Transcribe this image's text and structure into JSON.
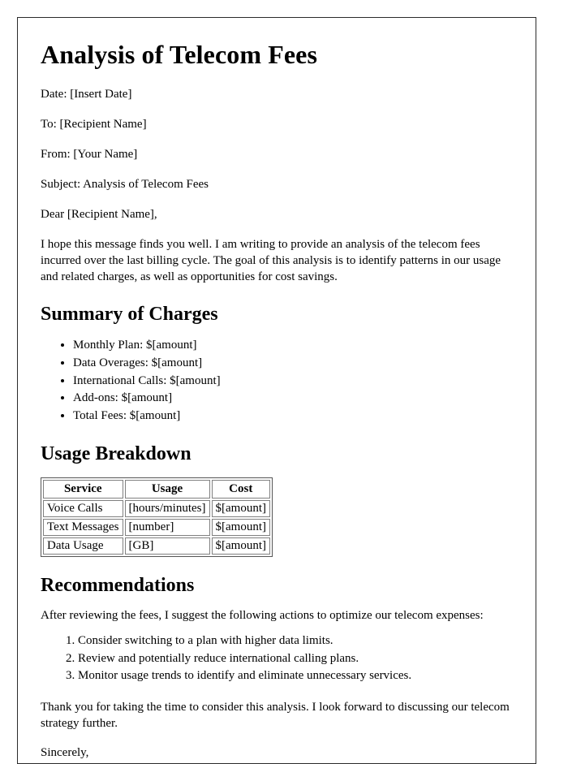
{
  "document": {
    "title": "Analysis of Telecom Fees",
    "header_lines": [
      "Date: [Insert Date]",
      "To: [Recipient Name]",
      "From: [Your Name]",
      "Subject: Analysis of Telecom Fees",
      "Dear [Recipient Name],"
    ],
    "intro_paragraph": "I hope this message finds you well. I am writing to provide an analysis of the telecom fees incurred over the last billing cycle. The goal of this analysis is to identify patterns in our usage and related charges, as well as opportunities for cost savings.",
    "summary": {
      "heading": "Summary of Charges",
      "items": [
        "Monthly Plan: $[amount]",
        "Data Overages: $[amount]",
        "International Calls: $[amount]",
        "Add-ons: $[amount]",
        "Total Fees: $[amount]"
      ]
    },
    "usage": {
      "heading": "Usage Breakdown",
      "columns": [
        "Service",
        "Usage",
        "Cost"
      ],
      "rows": [
        [
          "Voice Calls",
          "[hours/minutes]",
          "$[amount]"
        ],
        [
          "Text Messages",
          "[number]",
          "$[amount]"
        ],
        [
          "Data Usage",
          "[GB]",
          "$[amount]"
        ]
      ]
    },
    "recommendations": {
      "heading": "Recommendations",
      "lead_in": "After reviewing the fees, I suggest the following actions to optimize our telecom expenses:",
      "items": [
        "Consider switching to a plan with higher data limits.",
        "Review and potentially reduce international calling plans.",
        "Monitor usage trends to identify and eliminate unnecessary services."
      ]
    },
    "closing_paragraph": "Thank you for taking the time to consider this analysis. I look forward to discussing our telecom strategy further.",
    "signoff": "Sincerely,"
  },
  "style": {
    "page_border_color": "#2b2b2b",
    "text_color": "#000000",
    "table_border_color": "#808080",
    "background": "#ffffff"
  }
}
